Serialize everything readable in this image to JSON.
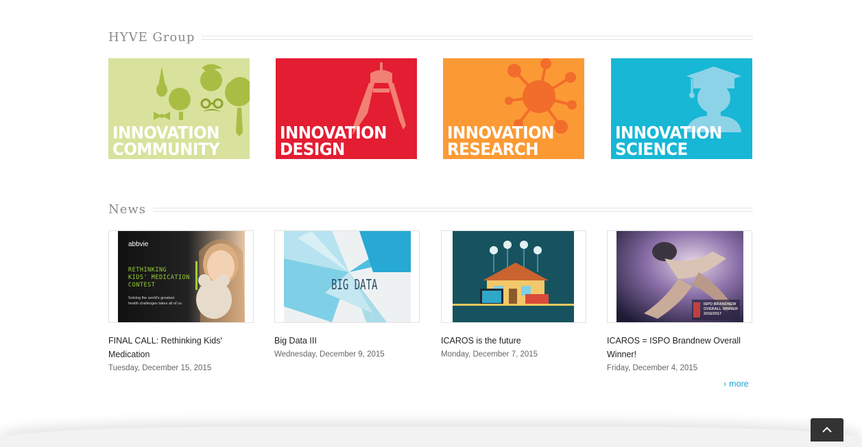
{
  "sections": {
    "group_title": "HYVE Group",
    "news_title": "News"
  },
  "tiles": [
    {
      "line1": "INNOVATION",
      "line2": "COMMUNITY",
      "color": "#d8e29c",
      "icon": "people-faces-icon"
    },
    {
      "line1": "INNOVATION",
      "line2": "DESIGN",
      "color": "#e31d32",
      "icon": "compass-icon"
    },
    {
      "line1": "INNOVATION",
      "line2": "RESEARCH",
      "color": "#fb9a34",
      "icon": "network-icon"
    },
    {
      "line1": "INNOVATION",
      "line2": "SCIENCE",
      "color": "#17b7d5",
      "icon": "graduate-icon"
    }
  ],
  "news": [
    {
      "title": "FINAL CALL: Rethinking Kids' Medication",
      "date": "Tuesday, December 15, 2015",
      "thumb": {
        "brand": "abbvie",
        "headline_1": "RETHINKING",
        "headline_2": "KIDS' MEDICATION",
        "headline_3": "CONTEST",
        "sub_1": "Solving the world's greatest",
        "sub_2": "health challenges takes all of us"
      }
    },
    {
      "title": "Big Data III",
      "date": "Wednesday, December 9, 2015",
      "thumb": {
        "headline": "BIG DATA"
      }
    },
    {
      "title": "ICAROS is the future",
      "date": "Monday, December 7, 2015",
      "thumb": {}
    },
    {
      "title": "ICAROS = ISPO Brandnew Overall Winner!",
      "date": "Friday, December 4, 2015",
      "thumb": {
        "caption_1": "ISPO BRANDNEW",
        "caption_2": "OVERALL WINNER",
        "caption_3": "2016/2017"
      }
    }
  ],
  "more_link": "more",
  "colors": {
    "accent": "#1ba7d9",
    "heading": "#8a8a8a"
  }
}
